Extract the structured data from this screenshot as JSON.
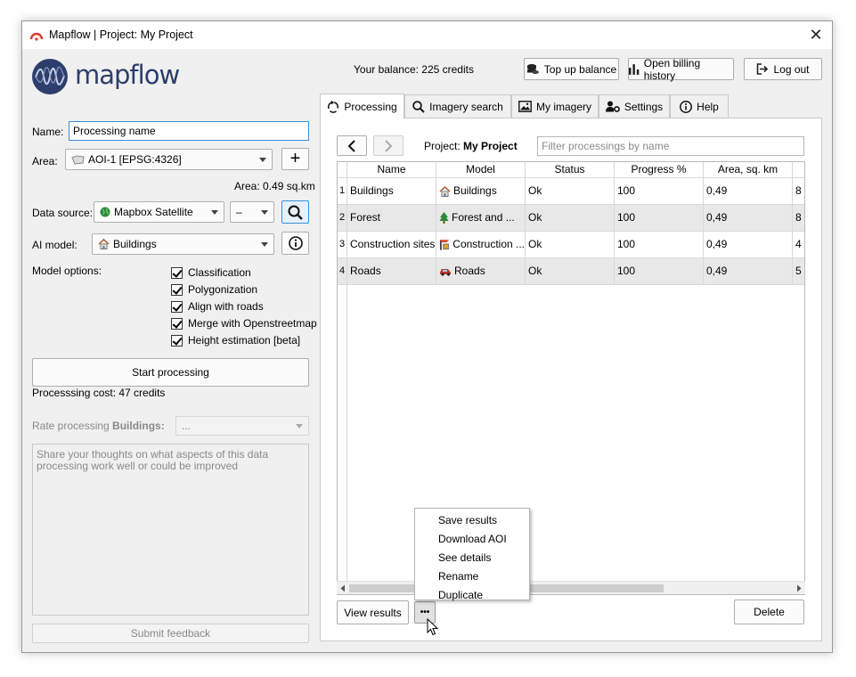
{
  "window": {
    "title": "Mapflow | Project: My Project",
    "close": "✕"
  },
  "brand": {
    "name": "mapflow"
  },
  "header": {
    "balance": "Your balance: 225 credits",
    "top_up": "Top up balance",
    "billing": "Open billing history",
    "logout": "Log out"
  },
  "left": {
    "name_label": "Name:",
    "name_value": "Processing name",
    "area_label": "Area:",
    "area_value": "AOI-1 [EPSG:4326]",
    "area_add": "+",
    "area_size": "Area: 0.49 sq.km",
    "datasource_label": "Data source:",
    "datasource_value": "Mapbox Satellite",
    "datasource_extra": "–",
    "model_label": "AI model:",
    "model_value": "Buildings",
    "options_label": "Model options:",
    "options": [
      "Classification",
      "Polygonization",
      "Align with roads",
      "Merge with Openstreetmap",
      "Height estimation [beta]"
    ],
    "start_button": "Start processing",
    "cost": "Processsing cost: 47 credits",
    "rate_prefix": "Rate processing ",
    "rate_model": "Buildings:",
    "rate_value": "...",
    "feedback_placeholder": "Share your thoughts on what aspects of this data processing work well or could be improved",
    "submit_button": "Submit feedback"
  },
  "tabs": [
    {
      "label": "Processing",
      "icon": "refresh-icon"
    },
    {
      "label": "Imagery search",
      "icon": "search-icon"
    },
    {
      "label": "My imagery",
      "icon": "image-icon"
    },
    {
      "label": "Settings",
      "icon": "user-gear-icon"
    },
    {
      "label": "Help",
      "icon": "info-icon"
    }
  ],
  "processing": {
    "project_label": "Project:",
    "project_name": "My Project",
    "filter_placeholder": "Filter processings by name",
    "columns": [
      "Name",
      "Model",
      "Status",
      "Progress %",
      "Area, sq. km",
      ""
    ],
    "rows": [
      {
        "num": "1",
        "name": "Buildings",
        "model": "Buildings",
        "model_icon": "house-icon",
        "status": "Ok",
        "progress": "100",
        "area": "0,49",
        "extra": "8"
      },
      {
        "num": "2",
        "name": "Forest",
        "model": "Forest and ...",
        "model_icon": "tree-icon",
        "status": "Ok",
        "progress": "100",
        "area": "0,49",
        "extra": "8"
      },
      {
        "num": "3",
        "name": "Construction sites",
        "model": "Construction ...",
        "model_icon": "construction-icon",
        "status": "Ok",
        "progress": "100",
        "area": "0,49",
        "extra": "4"
      },
      {
        "num": "4",
        "name": "Roads",
        "model": "Roads",
        "model_icon": "car-icon",
        "status": "Ok",
        "progress": "100",
        "area": "0,49",
        "extra": "5"
      }
    ],
    "view_results": "View results",
    "more": "•••",
    "delete": "Delete"
  },
  "context_menu": [
    "Save results",
    "Download AOI",
    "See details",
    "Rename",
    "Duplicate"
  ]
}
